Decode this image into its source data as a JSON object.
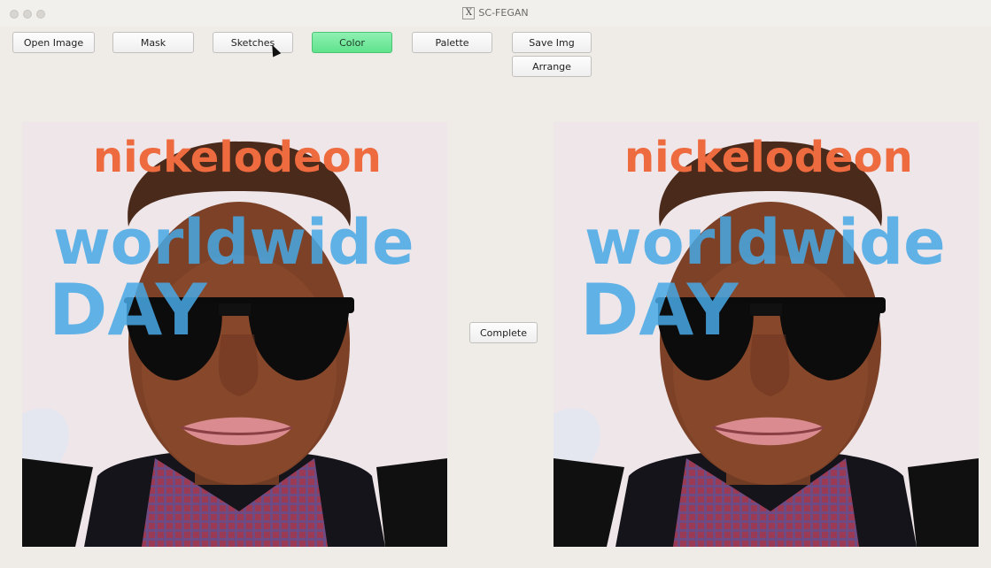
{
  "window": {
    "title": "SC-FEGAN",
    "title_icon": "x11-icon"
  },
  "toolbar": {
    "open_image_label": "Open Image",
    "mask_label": "Mask",
    "sketches_label": "Sketches",
    "color_label": "Color",
    "palette_label": "Palette",
    "save_img_label": "Save Img",
    "arrange_label": "Arrange",
    "active_color": "#67e694"
  },
  "main": {
    "complete_label": "Complete",
    "logo_line1": "nickelodeon",
    "logo_line2": "worldwide",
    "logo_line3": "DAY"
  }
}
